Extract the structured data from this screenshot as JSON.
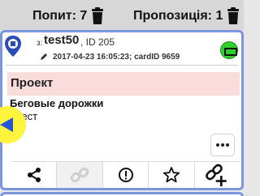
{
  "header": {
    "rejected_label": "Попит: 7",
    "proposals_label": "Пропозиція: 1"
  },
  "card": {
    "from_label": "з:",
    "title": "test50",
    "id_label": ", ID 205",
    "meta": "2017-04-23 16:05:23; cardID 9659",
    "category": "Проект",
    "subject": "Беговые дорожки",
    "tag": "#Тест",
    "status_color": "#2fcf2f",
    "accent_color": "#7d95df"
  },
  "icons": {
    "header_left": "trash-icon",
    "header_right": "trash-icon",
    "pin": "location-pin-icon",
    "meta": "pen-icon",
    "status": "battery-icon",
    "more": "more-dots-icon",
    "action_share": "share-icon",
    "action_link": "link-icon",
    "action_alert": "alert-icon",
    "action_star": "star-icon",
    "action_add_link": "add-link-icon"
  }
}
